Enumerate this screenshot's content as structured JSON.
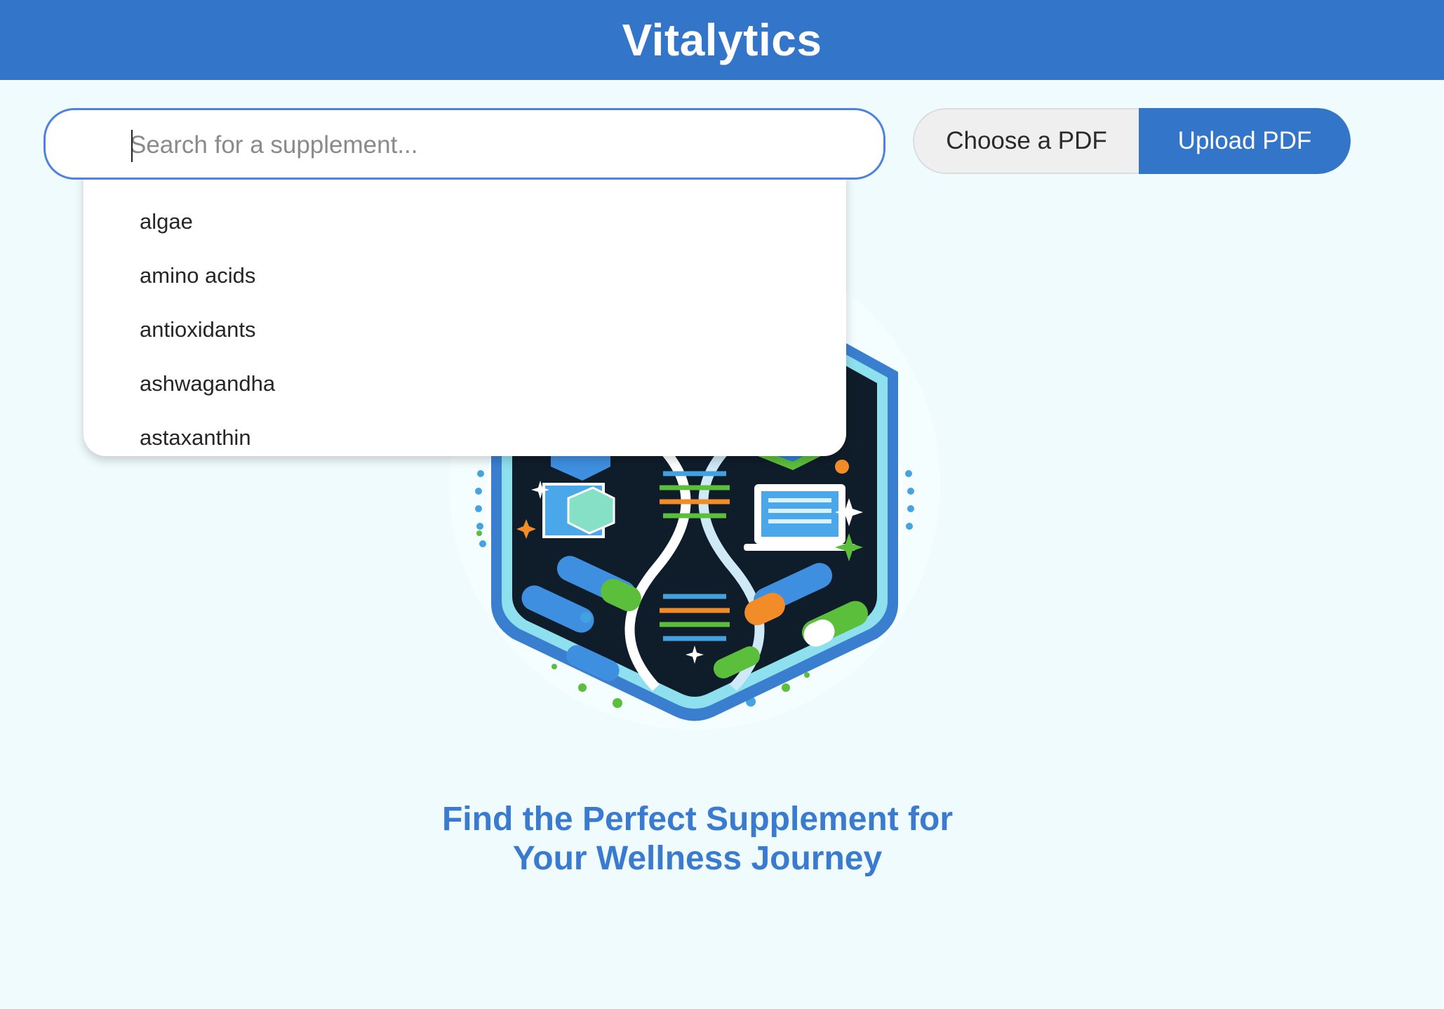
{
  "app": {
    "title": "Vitalytics"
  },
  "search": {
    "placeholder": "Search for a supplement...",
    "suggestions": [
      "algae",
      "amino acids",
      "antioxidants",
      "ashwagandha",
      "astaxanthin"
    ]
  },
  "pdf": {
    "choose_label": "Choose a PDF",
    "upload_label": "Upload PDF"
  },
  "hero": {
    "logo_icon": "dna-supplement-badge-icon",
    "tagline_line1": "Find the Perfect Supplement for",
    "tagline_line2": "Your Wellness Journey"
  },
  "colors": {
    "brand": "#3375c8",
    "background": "#effbfd",
    "tagline": "#3a7bd0"
  }
}
